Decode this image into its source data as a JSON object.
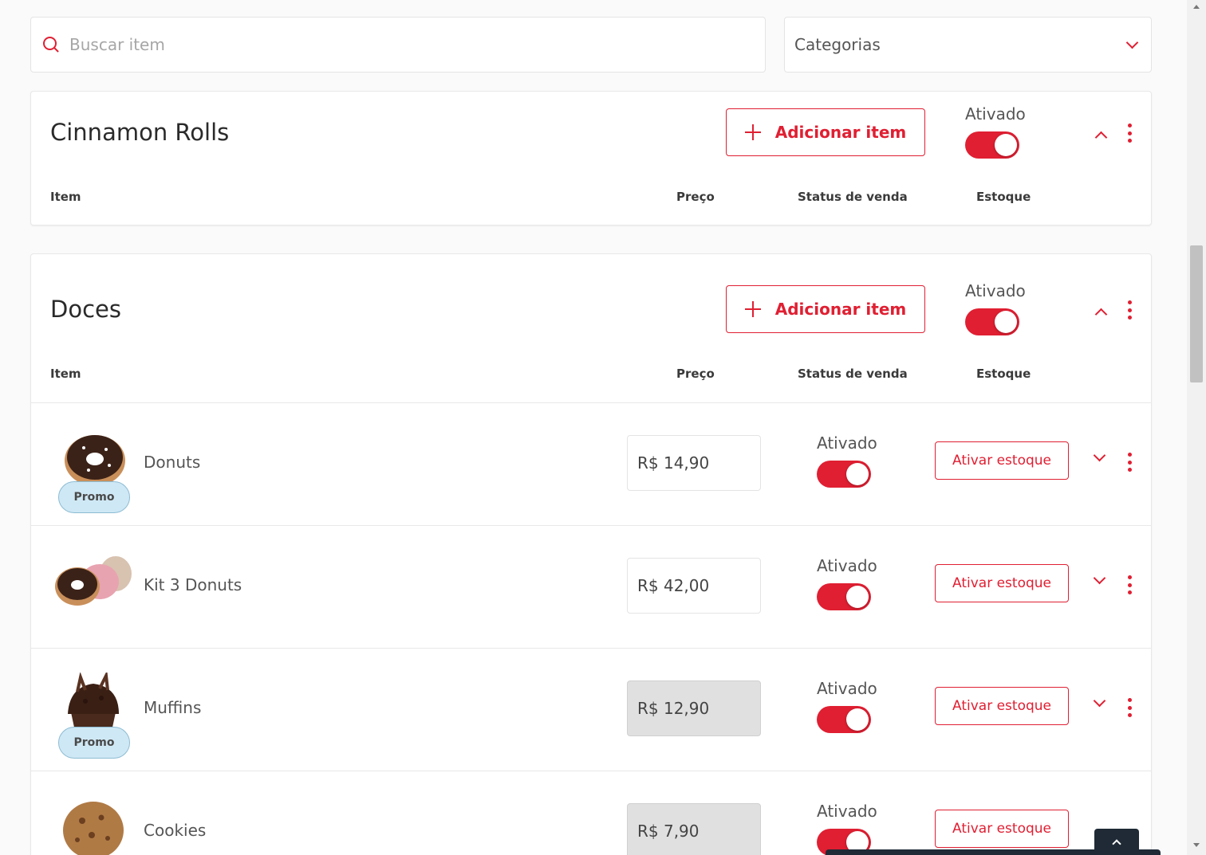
{
  "search": {
    "placeholder": "Buscar item"
  },
  "category_filter": {
    "label": "Categorias"
  },
  "categories": [
    {
      "title": "Cinnamon Rolls",
      "add_label": "Adicionar item",
      "status_label": "Ativado",
      "status_on": true,
      "columns": {
        "item": "Item",
        "price": "Preço",
        "sale_status": "Status de venda",
        "stock": "Estoque"
      },
      "items": []
    },
    {
      "title": "Doces",
      "add_label": "Adicionar item",
      "status_label": "Ativado",
      "status_on": true,
      "columns": {
        "item": "Item",
        "price": "Preço",
        "sale_status": "Status de venda",
        "stock": "Estoque"
      },
      "items": [
        {
          "name": "Donuts",
          "price": "R$ 14,90",
          "price_editable": true,
          "promo": "Promo",
          "status_label": "Ativado",
          "status_on": true,
          "stock_label": "Ativar estoque",
          "image": "donut-image"
        },
        {
          "name": "Kit 3 Donuts",
          "price": "R$ 42,00",
          "price_editable": true,
          "promo": "",
          "status_label": "Ativado",
          "status_on": true,
          "stock_label": "Ativar estoque",
          "image": "donut-kit-image"
        },
        {
          "name": "Muffins",
          "price": "R$ 12,90",
          "price_editable": false,
          "promo": "Promo",
          "status_label": "Ativado",
          "status_on": true,
          "stock_label": "Ativar estoque",
          "image": "muffin-image"
        },
        {
          "name": "Cookies",
          "price": "R$ 7,90",
          "price_editable": false,
          "promo": "",
          "status_label": "Ativado",
          "status_on": true,
          "stock_label": "Ativar estoque",
          "image": "cookie-image"
        }
      ]
    }
  ],
  "colors": {
    "accent": "#e01f32",
    "promo_bg": "#cfe8f5",
    "dark_bar": "#1f2a36"
  }
}
